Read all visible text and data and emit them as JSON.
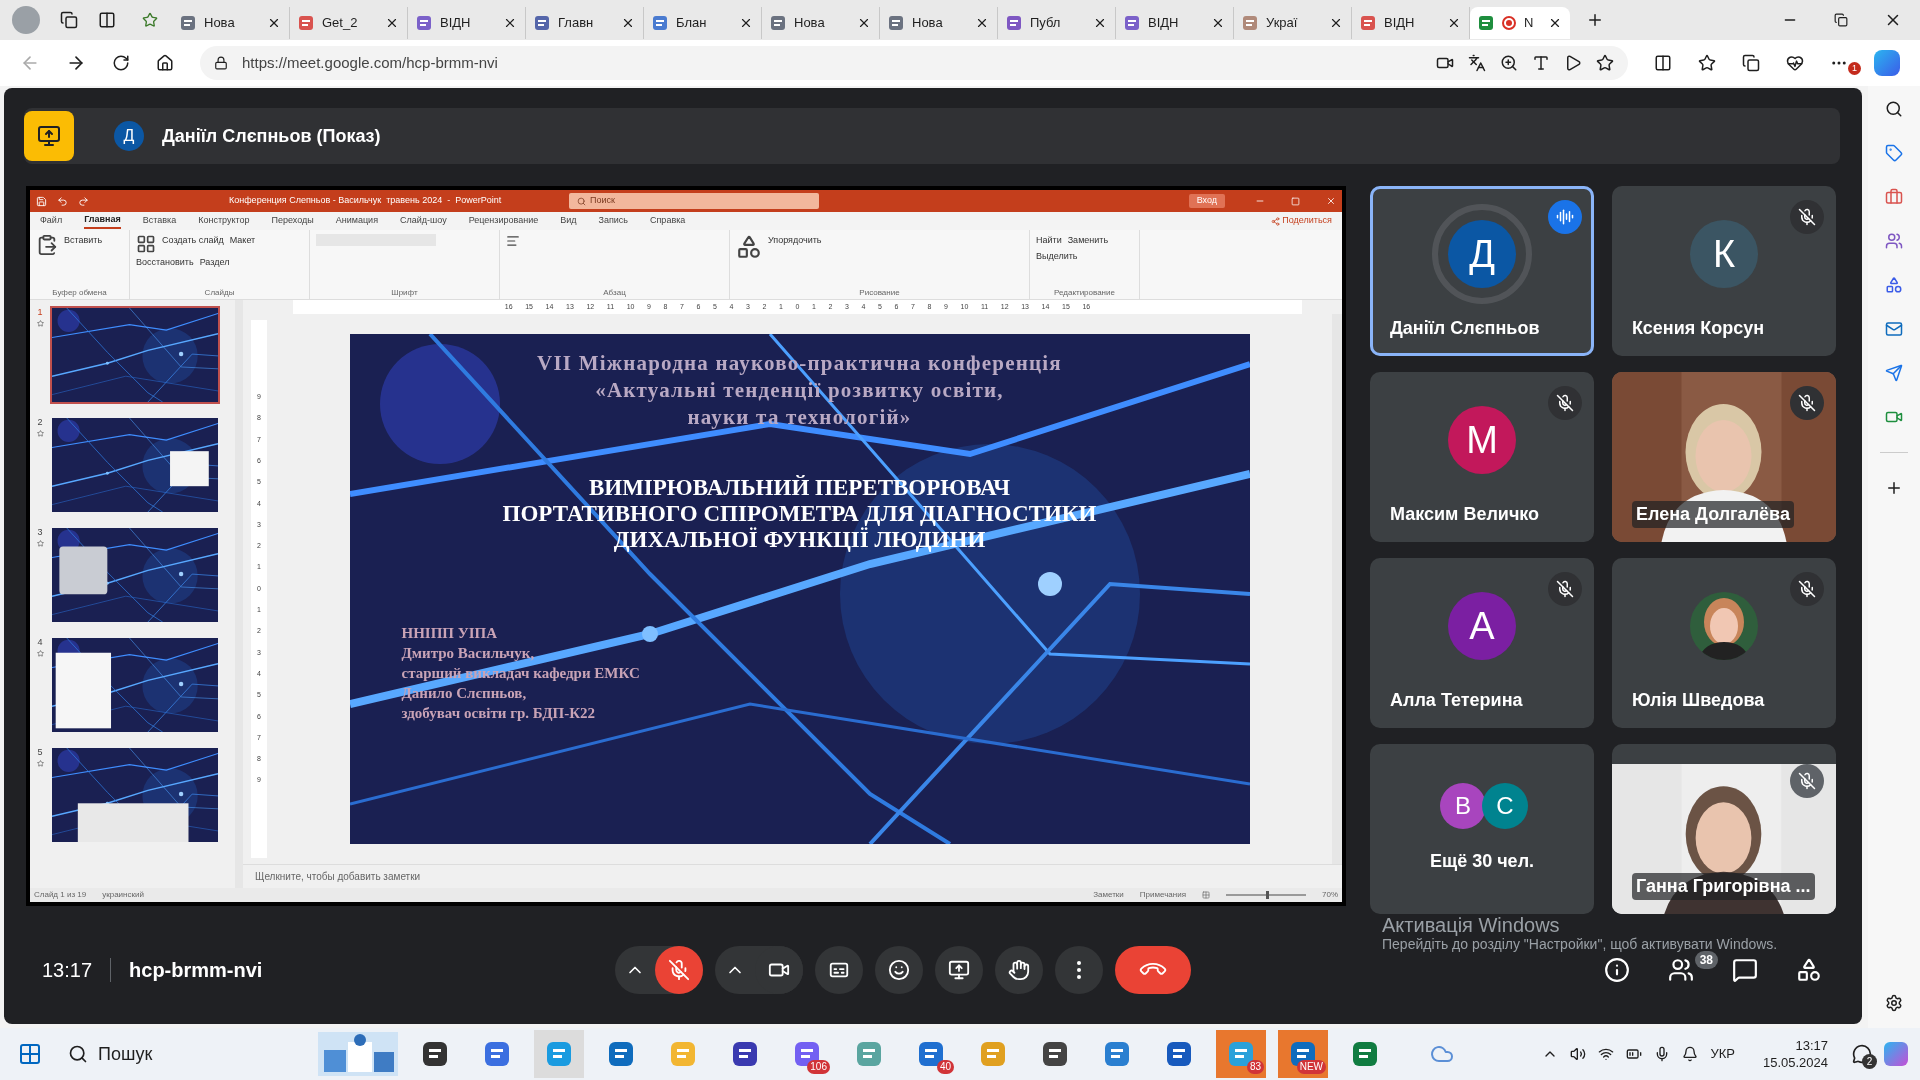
{
  "browser": {
    "tabs": [
      {
        "label": "Нова",
        "selected": false
      },
      {
        "label": "Get_2",
        "selected": false
      },
      {
        "label": "ВІДН",
        "selected": false
      },
      {
        "label": "Главн",
        "selected": false
      },
      {
        "label": "Блан",
        "selected": false
      },
      {
        "label": "Нова",
        "selected": false
      },
      {
        "label": "Нова",
        "selected": false
      },
      {
        "label": "Публ",
        "selected": false
      },
      {
        "label": "ВІДН",
        "selected": false
      },
      {
        "label": "Украї",
        "selected": false
      },
      {
        "label": "ВІДН",
        "selected": false
      },
      {
        "label": "N",
        "selected": true
      }
    ],
    "url": "https://meet.google.com/hcp-brmm-nvi",
    "alert_badge": "1"
  },
  "meeting": {
    "presenter": {
      "initial": "Д",
      "label": "Даніїл Слєпньов (Показ)"
    },
    "powerpoint": {
      "title": "Конференция Слепньов - Васильчук  травень 2024  -  PowerPoint",
      "search": "Поиск",
      "signin": "Вход",
      "tabs": [
        {
          "label": "Файл",
          "selected": false
        },
        {
          "label": "Главная",
          "selected": true
        },
        {
          "label": "Вставка",
          "selected": false
        },
        {
          "label": "Конструктор",
          "selected": false
        },
        {
          "label": "Переходы",
          "selected": false
        },
        {
          "label": "Анимация",
          "selected": false
        },
        {
          "label": "Слайд-шоу",
          "selected": false
        },
        {
          "label": "Рецензирование",
          "selected": false
        },
        {
          "label": "Вид",
          "selected": false
        },
        {
          "label": "Запись",
          "selected": false
        },
        {
          "label": "Справка",
          "selected": false
        }
      ],
      "share": "Поделиться",
      "groups": [
        {
          "label": "Буфер обмена",
          "buttons": [
            "Вставить"
          ]
        },
        {
          "label": "Слайды",
          "buttons": [
            "Создать слайд",
            "Макет",
            "Восстановить",
            "Раздел"
          ]
        },
        {
          "label": "Шрифт"
        },
        {
          "label": "Абзац"
        },
        {
          "label": "Рисование",
          "buttons": [
            "Упорядочить"
          ]
        },
        {
          "label": "Редактирование",
          "buttons": [
            "Найти",
            "Заменить",
            "Выделить"
          ]
        }
      ],
      "ruler_h": [
        "16",
        "15",
        "14",
        "13",
        "12",
        "11",
        "10",
        "9",
        "8",
        "7",
        "6",
        "5",
        "4",
        "3",
        "2",
        "1",
        "0",
        "1",
        "2",
        "3",
        "4",
        "5",
        "6",
        "7",
        "8",
        "9",
        "10",
        "11",
        "12",
        "13",
        "14",
        "15",
        "16"
      ],
      "ruler_v": [
        "9",
        "8",
        "7",
        "6",
        "5",
        "4",
        "3",
        "2",
        "1",
        "0",
        "1",
        "2",
        "3",
        "4",
        "5",
        "6",
        "7",
        "8",
        "9"
      ],
      "thumbnails": [
        {
          "number": "1",
          "selected": true
        },
        {
          "number": "2",
          "selected": false
        },
        {
          "number": "3",
          "selected": false
        },
        {
          "number": "4",
          "selected": false
        },
        {
          "number": "5",
          "selected": false
        }
      ],
      "slide": {
        "header": [
          "VII Міжнародна науково-практична конференція",
          "«Актуальні тенденції розвитку освіти,",
          "науки та технологій»"
        ],
        "title": [
          "ВИМІРЮВАЛЬНИЙ ПЕРЕТВОРЮВАЧ",
          "ПОРТАТИВНОГО СПІРОМЕТРА ДЛЯ ДІАГНОСТИКИ",
          "ДИХАЛЬНОЇ ФУНКЦІЇ ЛЮДИНИ"
        ],
        "authors": [
          "ННІПП УІПА",
          "Дмитро Васильчук,",
          "старший викладач кафедри ЕМКС",
          "Данило Слєпньов,",
          "здобувач освіти гр. БДП-К22"
        ]
      },
      "notes": "Щелкните, чтобы добавить заметки",
      "status": {
        "slide": "Слайд 1 из 19",
        "language": "украинский",
        "notes": "Заметки",
        "comments": "Примечания",
        "zoom": "70%",
        "level": 0.5
      }
    },
    "tiles": [
      {
        "kind": "avatar",
        "name": "Даніїл Слєпньов",
        "initial": "Д",
        "color": "#0b57a4",
        "speaking": true,
        "muted": false
      },
      {
        "kind": "avatar",
        "name": "Ксения Корсун",
        "initial": "К",
        "color": "#3b5563",
        "speaking": false,
        "muted": true
      },
      {
        "kind": "avatar",
        "name": "Максим Величко",
        "initial": "М",
        "color": "#c2185b",
        "speaking": false,
        "muted": true
      },
      {
        "kind": "video",
        "name": "Елена Долгалёва",
        "muted": true
      },
      {
        "kind": "avatar",
        "name": "Алла Тетерина",
        "initial": "А",
        "color": "#7b1fa2",
        "speaking": false,
        "muted": true
      },
      {
        "name": "Юлія Шведова",
        "speaking": false,
        "muted": true
      },
      {
        "kind": "more",
        "name": "Ещё 30 чел.",
        "initials": [
          {
            "letter": "В",
            "color": "#a845be"
          },
          {
            "letter": "С",
            "color": "#00838f"
          }
        ]
      },
      {
        "kind": "video",
        "name": "Ганна Григорівна ...",
        "speaking": false,
        "muted": true
      }
    ],
    "controls": {
      "time": "13:17",
      "code": "hcp-brmm-nvi",
      "mic_on": false,
      "participants_badge": "38"
    },
    "activation": {
      "title": "Активація Windows",
      "text": "Перейдіть до розділу \"Настройки\", щоб активувати Windows."
    }
  },
  "taskbar": {
    "search": "Пошук",
    "apps": [
      {
        "kind": "taskview",
        "active": false
      },
      {
        "kind": "copilot",
        "active": false
      },
      {
        "kind": "edge",
        "active": true
      },
      {
        "kind": "store",
        "active": false
      },
      {
        "kind": "folder",
        "active": false
      },
      {
        "kind": "disk",
        "active": false
      },
      {
        "kind": "viber",
        "active": false,
        "badge": "106"
      },
      {
        "kind": "notes",
        "active": false
      },
      {
        "kind": "mail",
        "active": false,
        "badge": "40"
      },
      {
        "kind": "chrome",
        "active": false
      },
      {
        "kind": "player",
        "active": false
      },
      {
        "kind": "photos",
        "active": false
      },
      {
        "kind": "word",
        "active": false
      },
      {
        "kind": "telegram",
        "active": true,
        "badge": "83"
      },
      {
        "kind": "outlook",
        "active": true,
        "badge": "NEW"
      },
      {
        "kind": "excel",
        "active": false
      }
    ],
    "language": "УКР",
    "time": "13:17",
    "date": "15.05.2024",
    "notifications": "2"
  }
}
